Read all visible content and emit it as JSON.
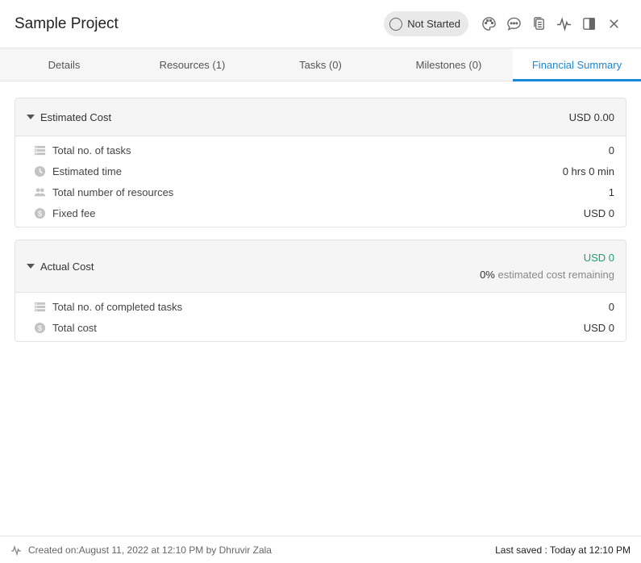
{
  "header": {
    "title": "Sample Project",
    "status_label": "Not Started",
    "icons": [
      "palette-icon",
      "comment-icon",
      "copy-icon",
      "activity-icon",
      "panel-icon",
      "close-icon"
    ]
  },
  "tabs": [
    {
      "label": "Details"
    },
    {
      "label": "Resources (1)"
    },
    {
      "label": "Tasks (0)"
    },
    {
      "label": "Milestones (0)"
    },
    {
      "label": "Financial Summary",
      "active": true
    }
  ],
  "estimated": {
    "title": "Estimated Cost",
    "total": "USD 0.00",
    "rows": [
      {
        "icon": "tasks-icon",
        "label": "Total no. of tasks",
        "value": "0"
      },
      {
        "icon": "clock-icon",
        "label": "Estimated time",
        "value": "0 hrs 0 min"
      },
      {
        "icon": "people-icon",
        "label": "Total number of resources",
        "value": "1"
      },
      {
        "icon": "dollar-icon",
        "label": "Fixed fee",
        "value": "USD 0"
      }
    ]
  },
  "actual": {
    "title": "Actual Cost",
    "total": "USD 0",
    "remaining_pct": "0%",
    "remaining_text": " estimated cost remaining",
    "rows": [
      {
        "icon": "tasks-icon",
        "label": "Total no. of completed tasks",
        "value": "0"
      },
      {
        "icon": "dollar-icon",
        "label": "Total cost",
        "value": "USD 0"
      }
    ]
  },
  "footer": {
    "created": "Created on:August 11, 2022 at 12:10 PM by Dhruvir Zala",
    "saved": "Last saved : Today at 12:10 PM"
  },
  "colors": {
    "accent": "#1a88d8",
    "green": "#22a06b"
  }
}
